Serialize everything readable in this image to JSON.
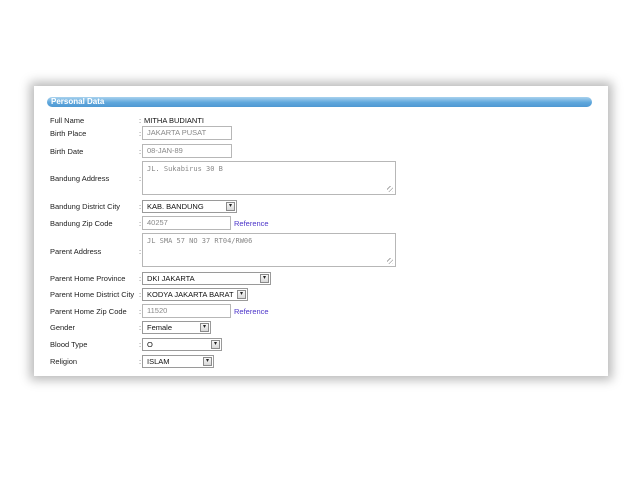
{
  "section": {
    "title": "Personal Data"
  },
  "fields": {
    "full_name": {
      "label": "Full Name",
      "value": "MITHA BUDIANTI"
    },
    "birth_place": {
      "label": "Birth Place",
      "value": "JAKARTA PUSAT"
    },
    "birth_date": {
      "label": "Birth Date",
      "value": "08-JAN-89"
    },
    "bandung_address": {
      "label": "Bandung Address",
      "value": "JL. Sukabirus 30 B"
    },
    "bandung_district_city": {
      "label": "Bandung District City",
      "value": "KAB. BANDUNG"
    },
    "bandung_zip_code": {
      "label": "Bandung Zip Code",
      "value": "40257",
      "link": "Reference"
    },
    "parent_address": {
      "label": "Parent Address",
      "value": "JL SMA 57 NO 37 RT04/RW06"
    },
    "parent_home_province": {
      "label": "Parent Home Province",
      "value": "DKI JAKARTA"
    },
    "parent_home_district_city": {
      "label": "Parent Home District City",
      "value": "KODYA JAKARTA BARAT"
    },
    "parent_home_zip_code": {
      "label": "Parent Home Zip Code",
      "value": "11520",
      "link": "Reference"
    },
    "gender": {
      "label": "Gender",
      "value": "Female"
    },
    "blood_type": {
      "label": "Blood Type",
      "value": "O"
    },
    "religion": {
      "label": "Religion",
      "value": "ISLAM"
    }
  },
  "colon": ":"
}
